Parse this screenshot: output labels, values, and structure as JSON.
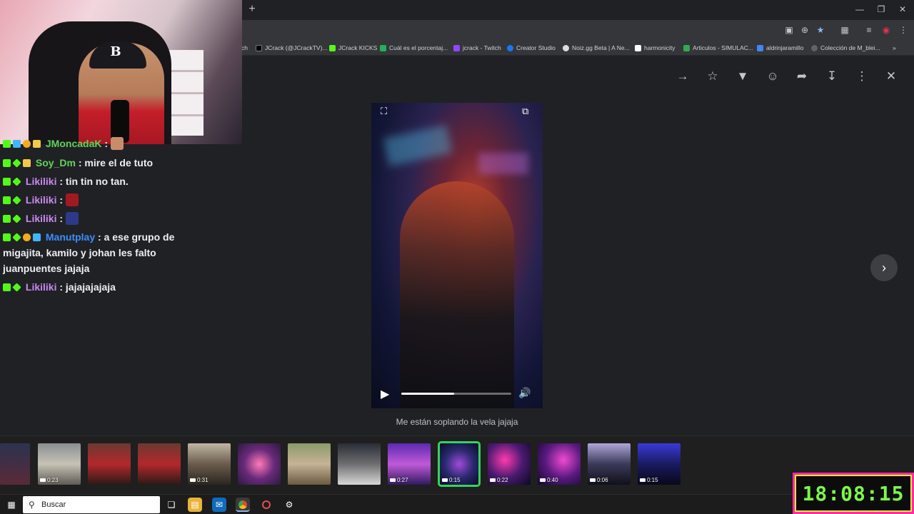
{
  "browser": {
    "new_tab_label": "+",
    "bookmarks": [
      {
        "label": "ch",
        "color": "#888888"
      },
      {
        "label": "JCrack (@JCrackTV)...",
        "color": "#000000"
      },
      {
        "label": "JCrack KICKS",
        "color": "#53fc18"
      },
      {
        "label": "Cuál es el porcentaj...",
        "color": "#20b15a"
      },
      {
        "label": "jcrack - Twitch",
        "color": "#9146ff"
      },
      {
        "label": "Creator Studio",
        "color": "#1877f2"
      },
      {
        "label": "Noiz.gg Beta | A Ne...",
        "color": "#dddddd"
      },
      {
        "label": "harmonicity",
        "color": "#ffffff"
      },
      {
        "label": "Articulos - SIMULAC...",
        "color": "#34a853"
      },
      {
        "label": "aldrinjaramillo",
        "color": "#4285f4"
      },
      {
        "label": "Colección de M_blei...",
        "color": "#3c4043"
      },
      {
        "label": "»",
        "color": ""
      }
    ]
  },
  "viewer": {
    "caption": "Me están soplando la vela jajaja",
    "progress_fraction": 0.48
  },
  "chat": {
    "messages": [
      {
        "user": "JMoncadaK",
        "text": ":"
      },
      {
        "user": "Soy_Dm",
        "text": ": mire el de tuto"
      },
      {
        "user": "Likiliki",
        "text": ": tin tin no tan."
      },
      {
        "user": "Likiliki",
        "text": ":"
      },
      {
        "user": "Likiliki",
        "text": ":"
      },
      {
        "user": "Manutplay",
        "text": ": a ese grupo de migajita, kamilo y johan les falto juanpuentes jajaja"
      },
      {
        "user": "Likiliki",
        "text": ": jajajajajaja"
      }
    ]
  },
  "filmstrip": {
    "durations": [
      "0:23",
      "0:31",
      "0:27",
      "0:15",
      "0:22",
      "0:40",
      "0:06",
      "0:15"
    ]
  },
  "taskbar": {
    "search_placeholder": "Buscar"
  },
  "clock": {
    "time": "18:08:15"
  }
}
